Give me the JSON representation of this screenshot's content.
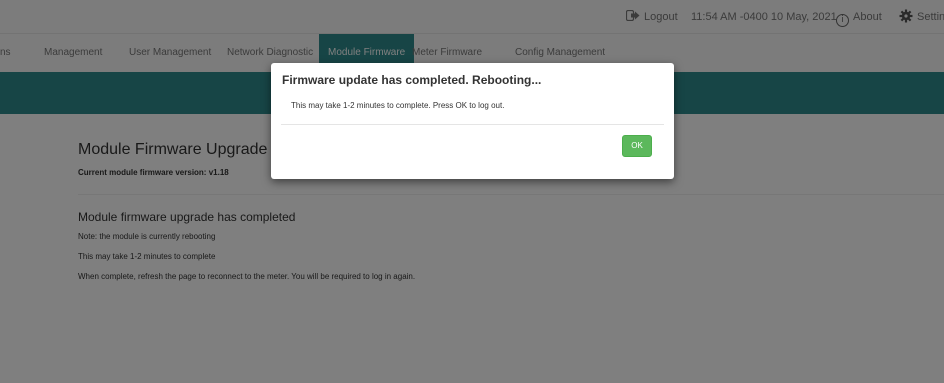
{
  "header": {
    "logout_label": "Logout",
    "datetime": "11:54 AM -0400 10 May, 2021",
    "about_label": "About",
    "settings_label": "Settings"
  },
  "tabs": [
    {
      "label": "ns"
    },
    {
      "label": "Management"
    },
    {
      "label": "User Management"
    },
    {
      "label": "Network Diagnostic"
    },
    {
      "label": "Module Firmware"
    },
    {
      "label": "Meter Firmware"
    },
    {
      "label": "Config Management"
    }
  ],
  "content": {
    "title": "Module Firmware Upgrade",
    "current_version": "Current module firmware version: v1.18",
    "status_title": "Module firmware upgrade has completed",
    "notes": [
      "Note: the module is currently rebooting",
      "This may take 1-2 minutes to complete",
      "When complete, refresh the page to reconnect to the meter. You will be required to log in again."
    ]
  },
  "modal": {
    "title": "Firmware update has completed. Rebooting...",
    "body": "This may take 1-2 minutes to complete. Press OK to log out.",
    "ok_label": "OK"
  },
  "colors": {
    "accent": "#2e8b8c",
    "ok_button": "#5cb85c"
  }
}
